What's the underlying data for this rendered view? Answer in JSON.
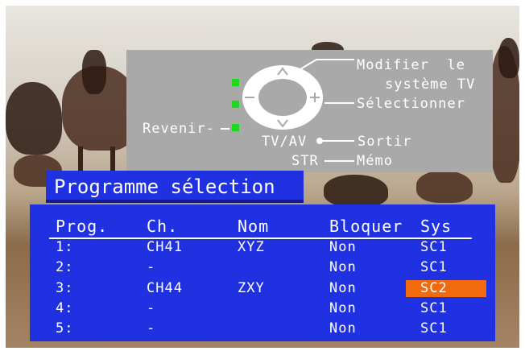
{
  "help": {
    "modify_label_line1": "Modifier  le",
    "modify_label_line2": "système TV",
    "select_label": "Sélectionner",
    "back_label": "Revenir-",
    "tvav_label": "TV/AV",
    "exit_label": "Sortir",
    "str_label": "STR",
    "memo_label": "Mémo"
  },
  "menu": {
    "title": "Programme sélection",
    "columns": [
      "Prog.",
      "Ch.",
      "Nom",
      "Bloquer",
      "Sys"
    ],
    "rows": [
      {
        "prog": "1:",
        "ch": "CH41",
        "nom": "XYZ",
        "bloquer": "Non",
        "sys": "SC1"
      },
      {
        "prog": "2:",
        "ch": "-",
        "nom": "",
        "bloquer": "Non",
        "sys": "SC1"
      },
      {
        "prog": "3:",
        "ch": "CH44",
        "nom": "ZXY",
        "bloquer": "Non",
        "sys": "SC2"
      },
      {
        "prog": "4:",
        "ch": "-",
        "nom": "",
        "bloquer": "Non",
        "sys": "SC1"
      },
      {
        "prog": "5:",
        "ch": "-",
        "nom": "",
        "bloquer": "Non",
        "sys": "SC1"
      }
    ],
    "selected_row": 2,
    "selected_column": "sys"
  },
  "colors": {
    "panel_blue": "#1f31e0",
    "highlight_orange": "#f26a0e",
    "help_gray": "#a9a9a9",
    "led_green": "#1dd81d"
  },
  "icons": [
    "dpad-icon",
    "up-arrow-icon",
    "down-arrow-icon",
    "minus-icon",
    "plus-icon",
    "green-led-icon"
  ]
}
